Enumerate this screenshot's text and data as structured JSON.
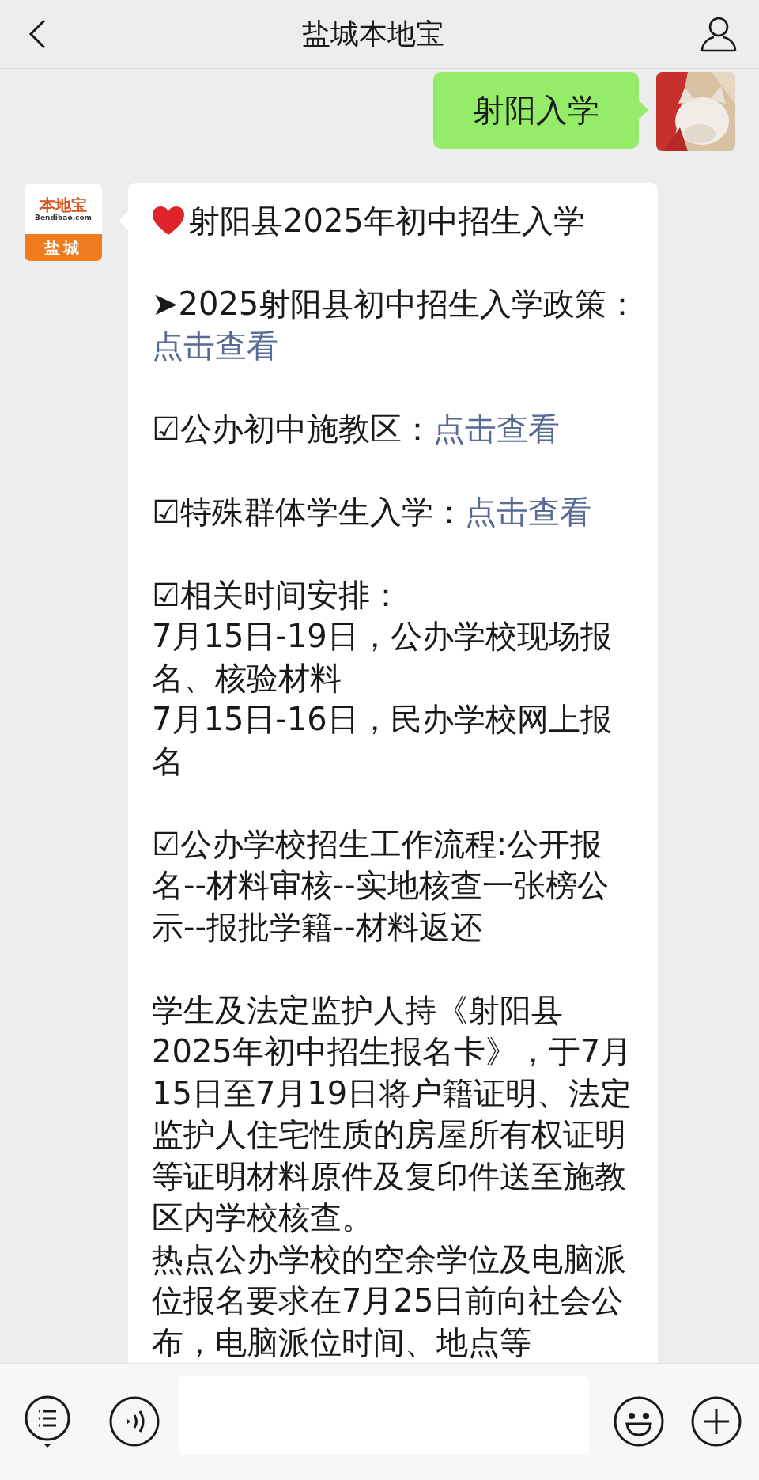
{
  "header": {
    "title": "盐城本地宝"
  },
  "messages": [
    {
      "kind": "outgoing",
      "text": "射阳入学"
    },
    {
      "kind": "incoming",
      "logo": {
        "brand": "本地宝",
        "site": "Bendibao.com",
        "city": "盐城"
      },
      "blocks": [
        {
          "kind": "heading",
          "text": "射阳县2025年初中招生入学"
        },
        {
          "kind": "item",
          "marker": "➤",
          "text": "2025射阳县初中招生入学政策：",
          "link": "点击查看"
        },
        {
          "kind": "item",
          "marker": "☑",
          "text": "公办初中施教区：",
          "link": "点击查看"
        },
        {
          "kind": "item",
          "marker": "☑",
          "text": "特殊群体学生入学：",
          "link": "点击查看"
        },
        {
          "kind": "item",
          "marker": "☑",
          "text": "相关时间安排：",
          "lines": [
            "7月15日-19日，公办学校现场报名、核验材料",
            "7月15日-16日，民办学校网上报名"
          ]
        },
        {
          "kind": "item",
          "marker": "☑",
          "text": "公办学校招生工作流程:公开报名--材料审核--实地核查一张榜公示--报批学籍--材料返还"
        },
        {
          "kind": "paragraphs",
          "lines": [
            "学生及法定监护人持《射阳县2025年初中招生报名卡》，于7月15日至7月19日将户籍证明、法定监护人住宅性质的房屋所有权证明等证明材料原件及复印件送至施教区内学校核查。",
            "热点公办学校的空余学位及电脑派位报名要求在7月25日前向社会公布，电脑派位时间、地点等"
          ]
        }
      ]
    }
  ]
}
